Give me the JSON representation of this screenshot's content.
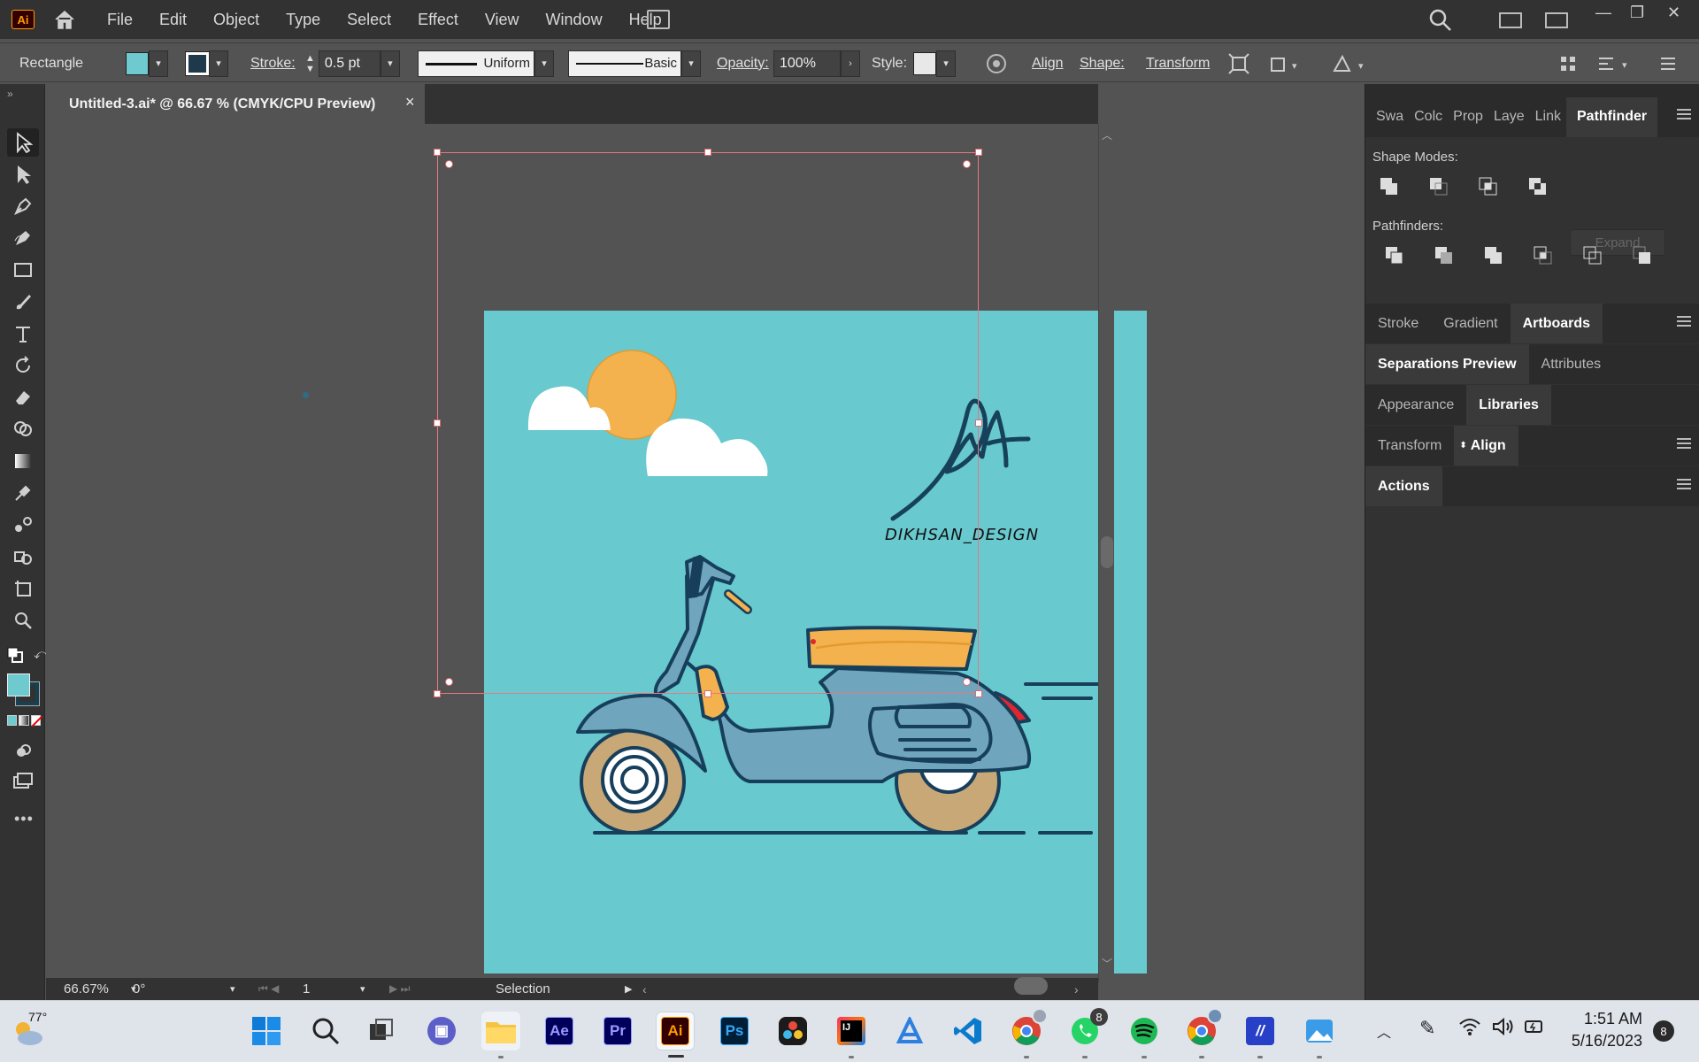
{
  "menubar": {
    "app_logo": "Ai",
    "items": [
      "File",
      "Edit",
      "Object",
      "Type",
      "Select",
      "Effect",
      "View",
      "Window",
      "Help"
    ]
  },
  "controlbar": {
    "tool_name": "Rectangle",
    "fill_color": "#6fcad0",
    "stroke_label": "Stroke:",
    "stroke_weight": "0.5 pt",
    "profile": "Uniform",
    "brush": "Basic",
    "opacity_label": "Opacity:",
    "opacity": "100%",
    "style_label": "Style:",
    "align": "Align",
    "shape": "Shape:",
    "transform": "Transform"
  },
  "document": {
    "tab_title": "Untitled-3.ai* @ 66.67 % (CMYK/CPU Preview)",
    "close_glyph": "×",
    "artboard_bg": "#68c9cf",
    "signature_text": "DIKHSAN_DESIGN"
  },
  "statusbar": {
    "zoom": "66.67%",
    "rotation": "0°",
    "artboard_number": "1",
    "tool_status": "Selection"
  },
  "panels": {
    "top_tabs": [
      "Swa",
      "Colc",
      "Prop",
      "Laye",
      "Link",
      "Pathfinder"
    ],
    "shape_modes_label": "Shape Modes:",
    "expand_button": "Expand",
    "pathfinders_label": "Pathfinders:",
    "group2_tabs": [
      "Stroke",
      "Gradient",
      "Artboards"
    ],
    "group3_tabs": [
      "Separations Preview",
      "Attributes"
    ],
    "group4_tabs": [
      "Appearance",
      "Libraries"
    ],
    "group5_tabs": [
      "Transform",
      "Align"
    ],
    "group6_tabs": [
      "Actions"
    ]
  },
  "taskbar": {
    "temperature": "77°",
    "time": "1:51 AM",
    "date": "5/16/2023",
    "whatsapp_badge": "8",
    "notification_count": "8",
    "apps": [
      "Ae",
      "Pr",
      "Ai",
      "Ps"
    ]
  }
}
